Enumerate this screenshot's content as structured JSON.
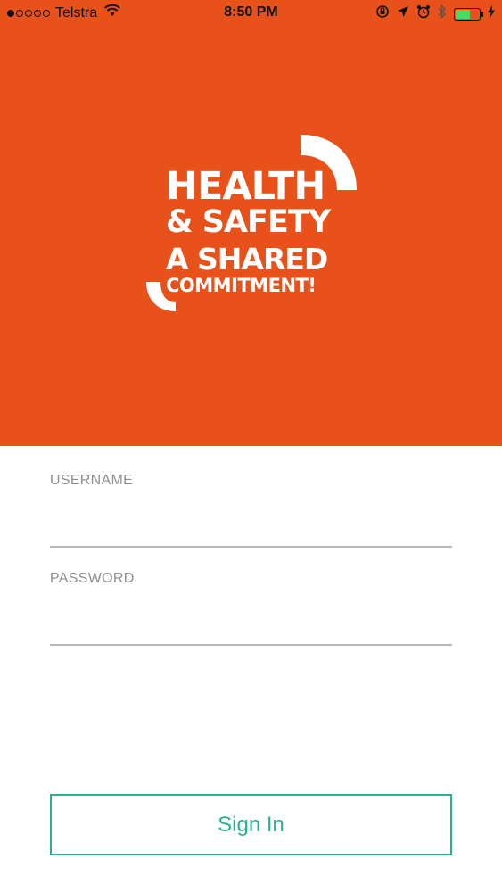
{
  "status_bar": {
    "carrier": "Telstra",
    "time": "8:50 PM",
    "signal_bars_filled": 1,
    "signal_bars_total": 5,
    "battery_level": 0.6,
    "icons": [
      "wifi-icon",
      "orientation-lock-icon",
      "location-arrow-icon",
      "alarm-icon",
      "bluetooth-icon",
      "battery-icon",
      "charging-icon"
    ]
  },
  "hero": {
    "background_color": "#E8521A",
    "logo": {
      "line1": "HEALTH",
      "line2": "& SAFETY",
      "line3": "A SHARED",
      "line4": "COMMITMENT!"
    }
  },
  "form": {
    "username": {
      "label": "USERNAME",
      "value": "",
      "placeholder": ""
    },
    "password": {
      "label": "PASSWORD",
      "value": "",
      "placeholder": ""
    }
  },
  "actions": {
    "sign_in_label": "Sign In",
    "accent_color": "#2bb190"
  }
}
